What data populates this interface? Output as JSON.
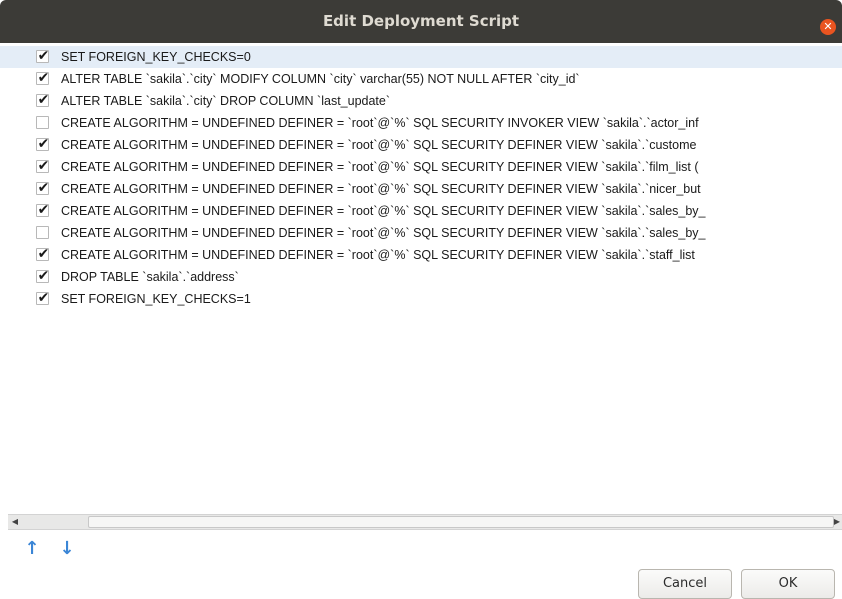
{
  "window": {
    "title": "Edit Deployment Script",
    "close_symbol": "✕"
  },
  "rows": [
    {
      "checked": true,
      "selected": true,
      "text": "SET FOREIGN_KEY_CHECKS=0"
    },
    {
      "checked": true,
      "selected": false,
      "text": "ALTER TABLE `sakila`.`city` MODIFY COLUMN `city` varchar(55) NOT NULL AFTER `city_id`"
    },
    {
      "checked": true,
      "selected": false,
      "text": "ALTER TABLE `sakila`.`city` DROP COLUMN `last_update`"
    },
    {
      "checked": false,
      "selected": false,
      "text": "CREATE ALGORITHM = UNDEFINED DEFINER = `root`@`%` SQL SECURITY INVOKER VIEW `sakila`.`actor_inf"
    },
    {
      "checked": true,
      "selected": false,
      "text": "CREATE ALGORITHM = UNDEFINED DEFINER = `root`@`%` SQL SECURITY DEFINER VIEW `sakila`.`custome"
    },
    {
      "checked": true,
      "selected": false,
      "text": "CREATE ALGORITHM = UNDEFINED DEFINER = `root`@`%` SQL SECURITY DEFINER VIEW `sakila`.`film_list ("
    },
    {
      "checked": true,
      "selected": false,
      "text": "CREATE ALGORITHM = UNDEFINED DEFINER = `root`@`%` SQL SECURITY DEFINER VIEW `sakila`.`nicer_but"
    },
    {
      "checked": true,
      "selected": false,
      "text": "CREATE ALGORITHM = UNDEFINED DEFINER = `root`@`%` SQL SECURITY DEFINER VIEW `sakila`.`sales_by_"
    },
    {
      "checked": false,
      "selected": false,
      "text": "CREATE ALGORITHM = UNDEFINED DEFINER = `root`@`%` SQL SECURITY DEFINER VIEW `sakila`.`sales_by_"
    },
    {
      "checked": true,
      "selected": false,
      "text": "CREATE ALGORITHM = UNDEFINED DEFINER = `root`@`%` SQL SECURITY DEFINER VIEW `sakila`.`staff_list"
    },
    {
      "checked": true,
      "selected": false,
      "text": "DROP TABLE `sakila`.`address`"
    },
    {
      "checked": true,
      "selected": false,
      "text": "SET FOREIGN_KEY_CHECKS=1"
    }
  ],
  "checkbox_mark": "✔",
  "scrollbar": {
    "left_arrow": "◀",
    "right_arrow": "▶"
  },
  "toolbar": {
    "move_up_symbol": "↑",
    "move_down_symbol": "↓"
  },
  "buttons": {
    "cancel_label": "Cancel",
    "ok_label": "OK"
  },
  "colors": {
    "titlebar": "#3c3b37",
    "close": "#e95420",
    "selection": "#e4edf7",
    "arrows": "#3b86d6"
  }
}
